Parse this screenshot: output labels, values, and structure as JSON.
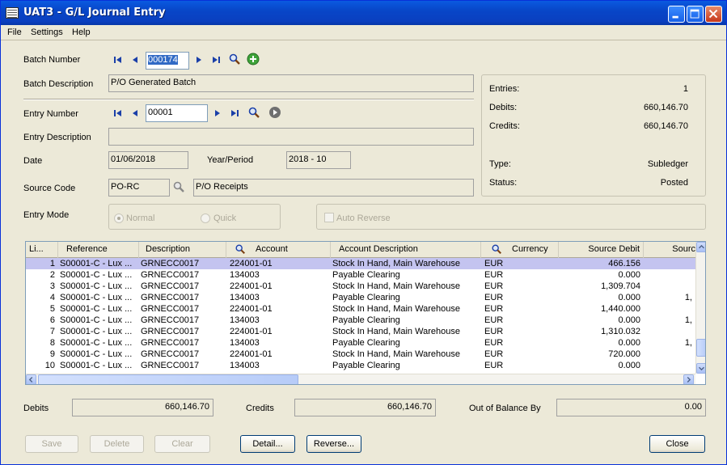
{
  "window": {
    "title": "UAT3 - G/L Journal Entry"
  },
  "menu": [
    "File",
    "Settings",
    "Help"
  ],
  "batch": {
    "number_label": "Batch Number",
    "number": "000174",
    "description_label": "Batch Description",
    "description": "P/O Generated Batch"
  },
  "entry": {
    "number_label": "Entry Number",
    "number": "00001",
    "description_label": "Entry Description",
    "description": "",
    "date_label": "Date",
    "date": "01/06/2018",
    "year_period_label": "Year/Period",
    "year_period": "2018 - 10",
    "source_code_label": "Source Code",
    "source_code": "PO-RC",
    "source_code_desc": "P/O Receipts",
    "mode_label": "Entry Mode",
    "mode_options": [
      "Normal",
      "Quick"
    ],
    "auto_reverse_label": "Auto Reverse"
  },
  "summary": {
    "entries_label": "Entries:",
    "entries": "1",
    "debits_label": "Debits:",
    "debits": "660,146.70",
    "credits_label": "Credits:",
    "credits": "660,146.70",
    "type_label": "Type:",
    "type": "Subledger",
    "status_label": "Status:",
    "status": "Posted"
  },
  "grid": {
    "columns": [
      "Li...",
      "Reference",
      "Description",
      "Account",
      "Account Description",
      "Currency",
      "Source Debit",
      "Sourc"
    ],
    "rows": [
      {
        "line": "1",
        "ref": "S00001-C - Lux ...",
        "desc": "GRNECC0017",
        "account": "224001-01",
        "acct_desc": "Stock In Hand, Main Warehouse",
        "currency": "EUR",
        "debit": "466.156",
        "credit": ""
      },
      {
        "line": "2",
        "ref": "S00001-C - Lux ...",
        "desc": "GRNECC0017",
        "account": "134003",
        "acct_desc": "Payable Clearing",
        "currency": "EUR",
        "debit": "0.000",
        "credit": ""
      },
      {
        "line": "3",
        "ref": "S00001-C - Lux ...",
        "desc": "GRNECC0017",
        "account": "224001-01",
        "acct_desc": "Stock In Hand, Main Warehouse",
        "currency": "EUR",
        "debit": "1,309.704",
        "credit": ""
      },
      {
        "line": "4",
        "ref": "S00001-C - Lux ...",
        "desc": "GRNECC0017",
        "account": "134003",
        "acct_desc": "Payable Clearing",
        "currency": "EUR",
        "debit": "0.000",
        "credit": "1,"
      },
      {
        "line": "5",
        "ref": "S00001-C - Lux ...",
        "desc": "GRNECC0017",
        "account": "224001-01",
        "acct_desc": "Stock In Hand, Main Warehouse",
        "currency": "EUR",
        "debit": "1,440.000",
        "credit": ""
      },
      {
        "line": "6",
        "ref": "S00001-C - Lux ...",
        "desc": "GRNECC0017",
        "account": "134003",
        "acct_desc": "Payable Clearing",
        "currency": "EUR",
        "debit": "0.000",
        "credit": "1,"
      },
      {
        "line": "7",
        "ref": "S00001-C - Lux ...",
        "desc": "GRNECC0017",
        "account": "224001-01",
        "acct_desc": "Stock In Hand, Main Warehouse",
        "currency": "EUR",
        "debit": "1,310.032",
        "credit": ""
      },
      {
        "line": "8",
        "ref": "S00001-C - Lux ...",
        "desc": "GRNECC0017",
        "account": "134003",
        "acct_desc": "Payable Clearing",
        "currency": "EUR",
        "debit": "0.000",
        "credit": "1,"
      },
      {
        "line": "9",
        "ref": "S00001-C - Lux ...",
        "desc": "GRNECC0017",
        "account": "224001-01",
        "acct_desc": "Stock In Hand, Main Warehouse",
        "currency": "EUR",
        "debit": "720.000",
        "credit": ""
      },
      {
        "line": "10",
        "ref": "S00001-C - Lux ...",
        "desc": "GRNECC0017",
        "account": "134003",
        "acct_desc": "Payable Clearing",
        "currency": "EUR",
        "debit": "0.000",
        "credit": ""
      }
    ]
  },
  "totals": {
    "debits_label": "Debits",
    "debits": "660,146.70",
    "credits_label": "Credits",
    "credits": "660,146.70",
    "out_of_balance_label": "Out of Balance By",
    "out_of_balance": "0.00"
  },
  "buttons": {
    "save": "Save",
    "delete": "Delete",
    "clear": "Clear",
    "detail": "Detail...",
    "reverse": "Reverse...",
    "close": "Close"
  },
  "icons": {
    "first": "first-record-icon",
    "prev": "previous-record-icon",
    "next": "next-record-icon",
    "last": "last-record-icon",
    "finder": "magnifier-icon",
    "new": "add-new-icon",
    "go": "go-icon"
  }
}
